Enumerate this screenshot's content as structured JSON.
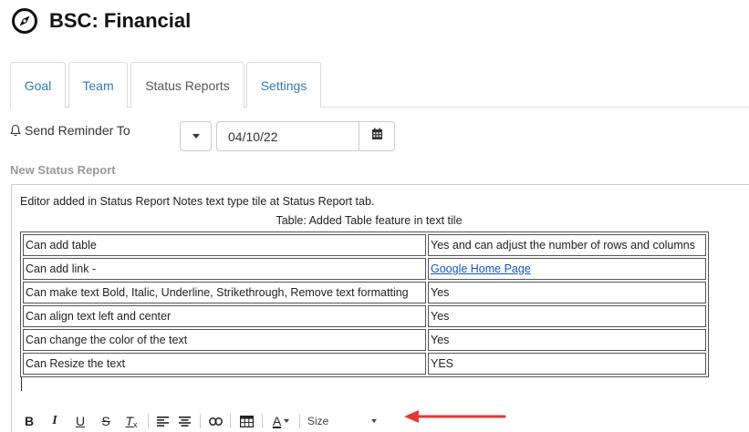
{
  "header": {
    "title": "BSC: Financial",
    "icon": "compass-icon"
  },
  "tabs": [
    {
      "label": "Goal",
      "active": false
    },
    {
      "label": "Team",
      "active": false
    },
    {
      "label": "Status Reports",
      "active": true
    },
    {
      "label": "Settings",
      "active": false
    }
  ],
  "reminder": {
    "label": "Send Reminder To",
    "icon": "bell-icon",
    "date_value": "04/10/22"
  },
  "section_title": "New Status Report",
  "editor": {
    "intro": "Editor added in Status Report Notes text type tile at Status Report tab.",
    "caption": "Table: Added Table feature in text tile",
    "rows": [
      [
        "Can add table",
        "Yes and can adjust the number of rows and columns"
      ],
      [
        "Can add link -",
        "Google Home Page"
      ],
      [
        "Can make text Bold, Italic, Underline, Strikethrough, Remove text formatting",
        "Yes"
      ],
      [
        "Can align text left and center",
        "Yes"
      ],
      [
        "Can change the color of the text",
        "Yes"
      ],
      [
        "Can Resize the text",
        "YES"
      ]
    ]
  },
  "toolbar": {
    "bold": "B",
    "italic": "I",
    "underline": "U",
    "strike": "S",
    "clear_format": "T",
    "clear_format_sub": "x",
    "color": "A",
    "size_label": "Size"
  },
  "colors": {
    "link": "#337ab7",
    "annotation_arrow": "#e53935",
    "section_label": "#999999"
  }
}
